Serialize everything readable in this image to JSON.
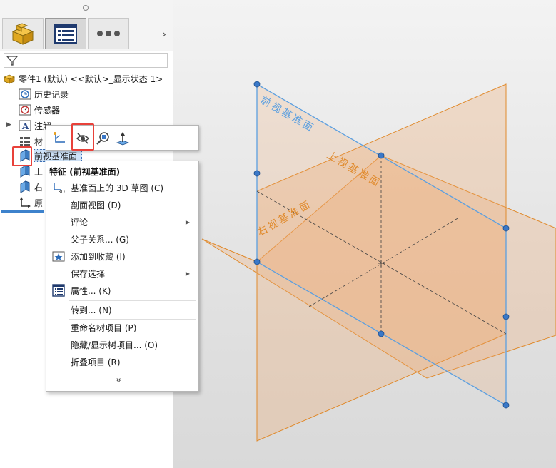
{
  "feature_tree": {
    "root": {
      "label": "零件1 (默认) <<默认>_显示状态 1>"
    },
    "items": [
      {
        "label": "历史记录",
        "icon": "history-icon"
      },
      {
        "label": "传感器",
        "icon": "sensor-icon"
      },
      {
        "label": "注解",
        "icon": "annotation-icon"
      },
      {
        "label": "材",
        "icon": "material-icon"
      },
      {
        "label": "前视基准面",
        "icon": "plane-icon"
      },
      {
        "label": "上",
        "icon": "plane-icon"
      },
      {
        "label": "右",
        "icon": "plane-icon"
      },
      {
        "label": "原",
        "icon": "origin-icon"
      }
    ]
  },
  "tabs": [
    {
      "name": "FeatureManager",
      "icon": "part-icon"
    },
    {
      "name": "PropertyManager",
      "icon": "property-list-icon"
    },
    {
      "name": "More",
      "icon": "more-icon"
    }
  ],
  "context_menu": {
    "header": "特征 (前视基准面)",
    "items": [
      {
        "label": "基准面上的 3D 草图 (C)",
        "icon": "3d-sketch-icon",
        "submenu": false
      },
      {
        "label": "剖面视图 (D)",
        "icon": "",
        "submenu": false
      },
      {
        "label": "评论",
        "icon": "",
        "submenu": true
      },
      {
        "label": "父子关系... (G)",
        "icon": "",
        "submenu": false
      },
      {
        "label": "添加到收藏 (I)",
        "icon": "favorite-icon",
        "submenu": false
      },
      {
        "label": "保存选择",
        "icon": "",
        "submenu": true
      },
      {
        "label": "属性... (K)",
        "icon": "properties-icon",
        "submenu": false
      },
      {
        "label": "转到... (N)",
        "icon": "",
        "submenu": false
      },
      {
        "label": "重命名树项目 (P)",
        "icon": "",
        "submenu": false
      },
      {
        "label": "隐藏/显示树项目... (O)",
        "icon": "",
        "submenu": false
      },
      {
        "label": "折叠项目 (R)",
        "icon": "",
        "submenu": false
      }
    ],
    "more": "»"
  },
  "context_toolbar": {
    "icons": [
      "sketch-icon",
      "hide-show-icon",
      "zoom-to-selection-icon",
      "normal-to-icon"
    ]
  },
  "graphics": {
    "planes": [
      {
        "label": "前视基准面",
        "color": "#5b9fe0"
      },
      {
        "label": "上视基准面",
        "color": "#e08a2c"
      },
      {
        "label": "右视基准面",
        "color": "#e08a2c"
      }
    ]
  },
  "colors": {
    "highlight_red": "#e8413a",
    "selection_blue": "#cfe3f8",
    "front_plane_blue": "#5b9fe0",
    "orange_plane": "#e08a2c"
  }
}
